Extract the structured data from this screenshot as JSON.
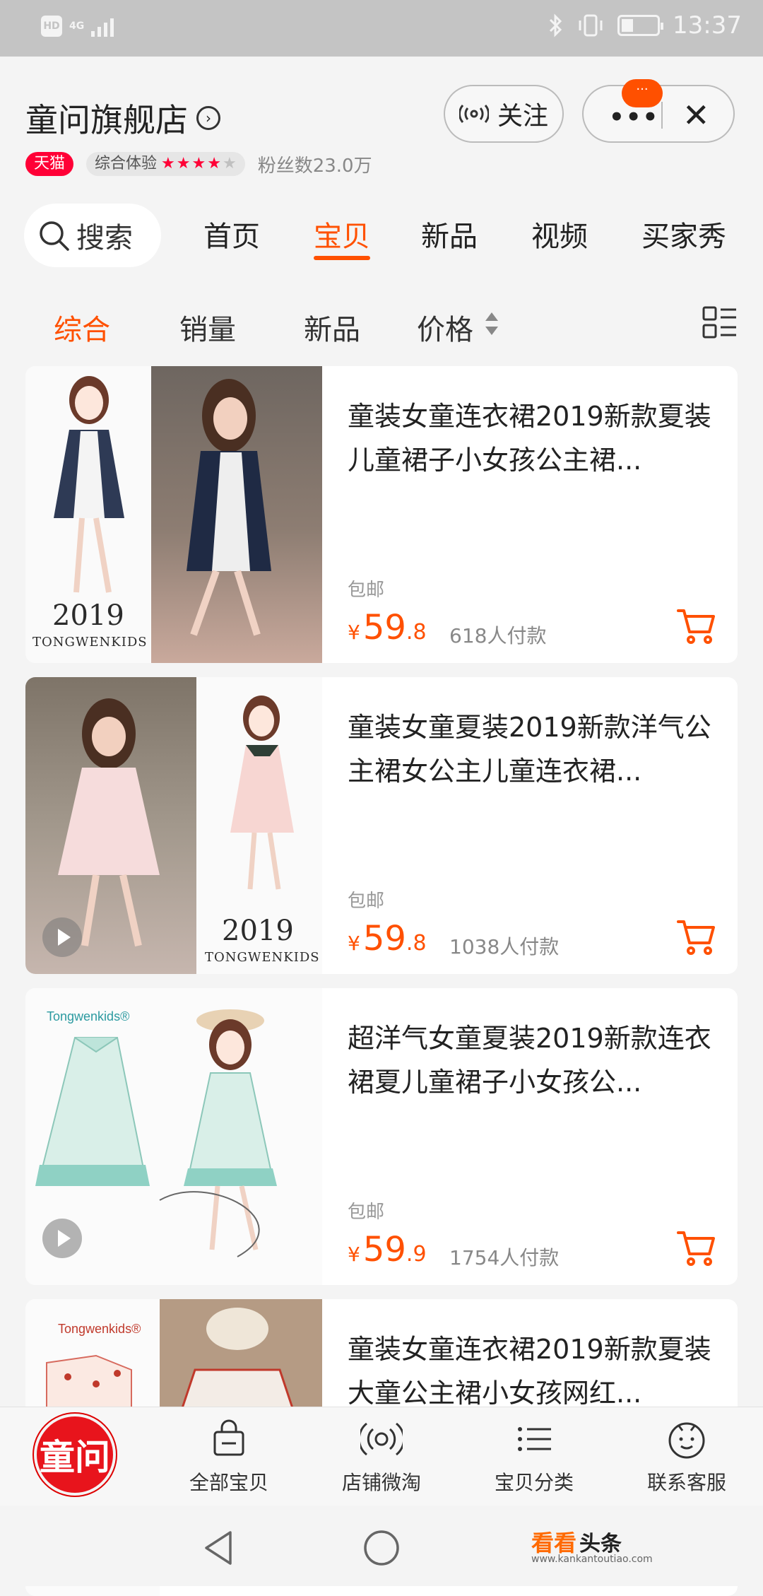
{
  "status_bar": {
    "network_hd": "HD",
    "network_type": "4G",
    "time": "13:37"
  },
  "header": {
    "store_name": "童问旗舰店",
    "follow_label": "关注",
    "capsule_badge": "···",
    "tmall_label": "天猫",
    "experience_label": "综合体验",
    "experience_stars": 4,
    "fans_text": "粉丝数23.0万"
  },
  "nav": {
    "search_label": "搜索",
    "tabs": [
      {
        "label": "首页"
      },
      {
        "label": "宝贝",
        "active": true
      },
      {
        "label": "新品"
      },
      {
        "label": "视频"
      },
      {
        "label": "买家秀"
      }
    ]
  },
  "sort": {
    "items": [
      {
        "label": "综合",
        "active": true
      },
      {
        "label": "销量"
      },
      {
        "label": "新品"
      },
      {
        "label": "价格"
      }
    ]
  },
  "products": [
    {
      "title": "童装女童连衣裙2019新款夏装儿童裙子小女孩公主裙...",
      "shipping": "包邮",
      "currency": "¥",
      "price_int": "59",
      "price_dec": ".8",
      "payers": "618人付款",
      "image_year": "2019",
      "image_brand": "TONGWENKIDS"
    },
    {
      "title": "童装女童夏装2019新款洋气公主裙女公主儿童连衣裙...",
      "shipping": "包邮",
      "currency": "¥",
      "price_int": "59",
      "price_dec": ".8",
      "payers": "1038人付款",
      "image_year": "2019",
      "image_brand": "TONGWENKIDS"
    },
    {
      "title": "超洋气女童夏装2019新款连衣裙夏儿童裙子小女孩公...",
      "shipping": "包邮",
      "currency": "¥",
      "price_int": "59",
      "price_dec": ".9",
      "payers": "1754人付款",
      "image_brand_script": "Tongwenkids®"
    },
    {
      "title": "童装女童连衣裙2019新款夏装大童公主裙小女孩网红...",
      "image_brand_script": "Tongwenkids®"
    }
  ],
  "bottom_bar": {
    "logo_text": "童问",
    "tabs": [
      {
        "label": "全部宝贝",
        "icon": "shopping-bag-icon"
      },
      {
        "label": "店铺微淘",
        "icon": "broadcast-icon"
      },
      {
        "label": "宝贝分类",
        "icon": "category-list-icon"
      },
      {
        "label": "联系客服",
        "icon": "customer-service-icon"
      }
    ]
  },
  "watermark": {
    "main": "看看",
    "sub": "头条",
    "url": "www.kankantoutiao.com"
  },
  "colors": {
    "accent": "#ff5000",
    "tmall": "#ff0036",
    "logo": "#e8141c"
  }
}
